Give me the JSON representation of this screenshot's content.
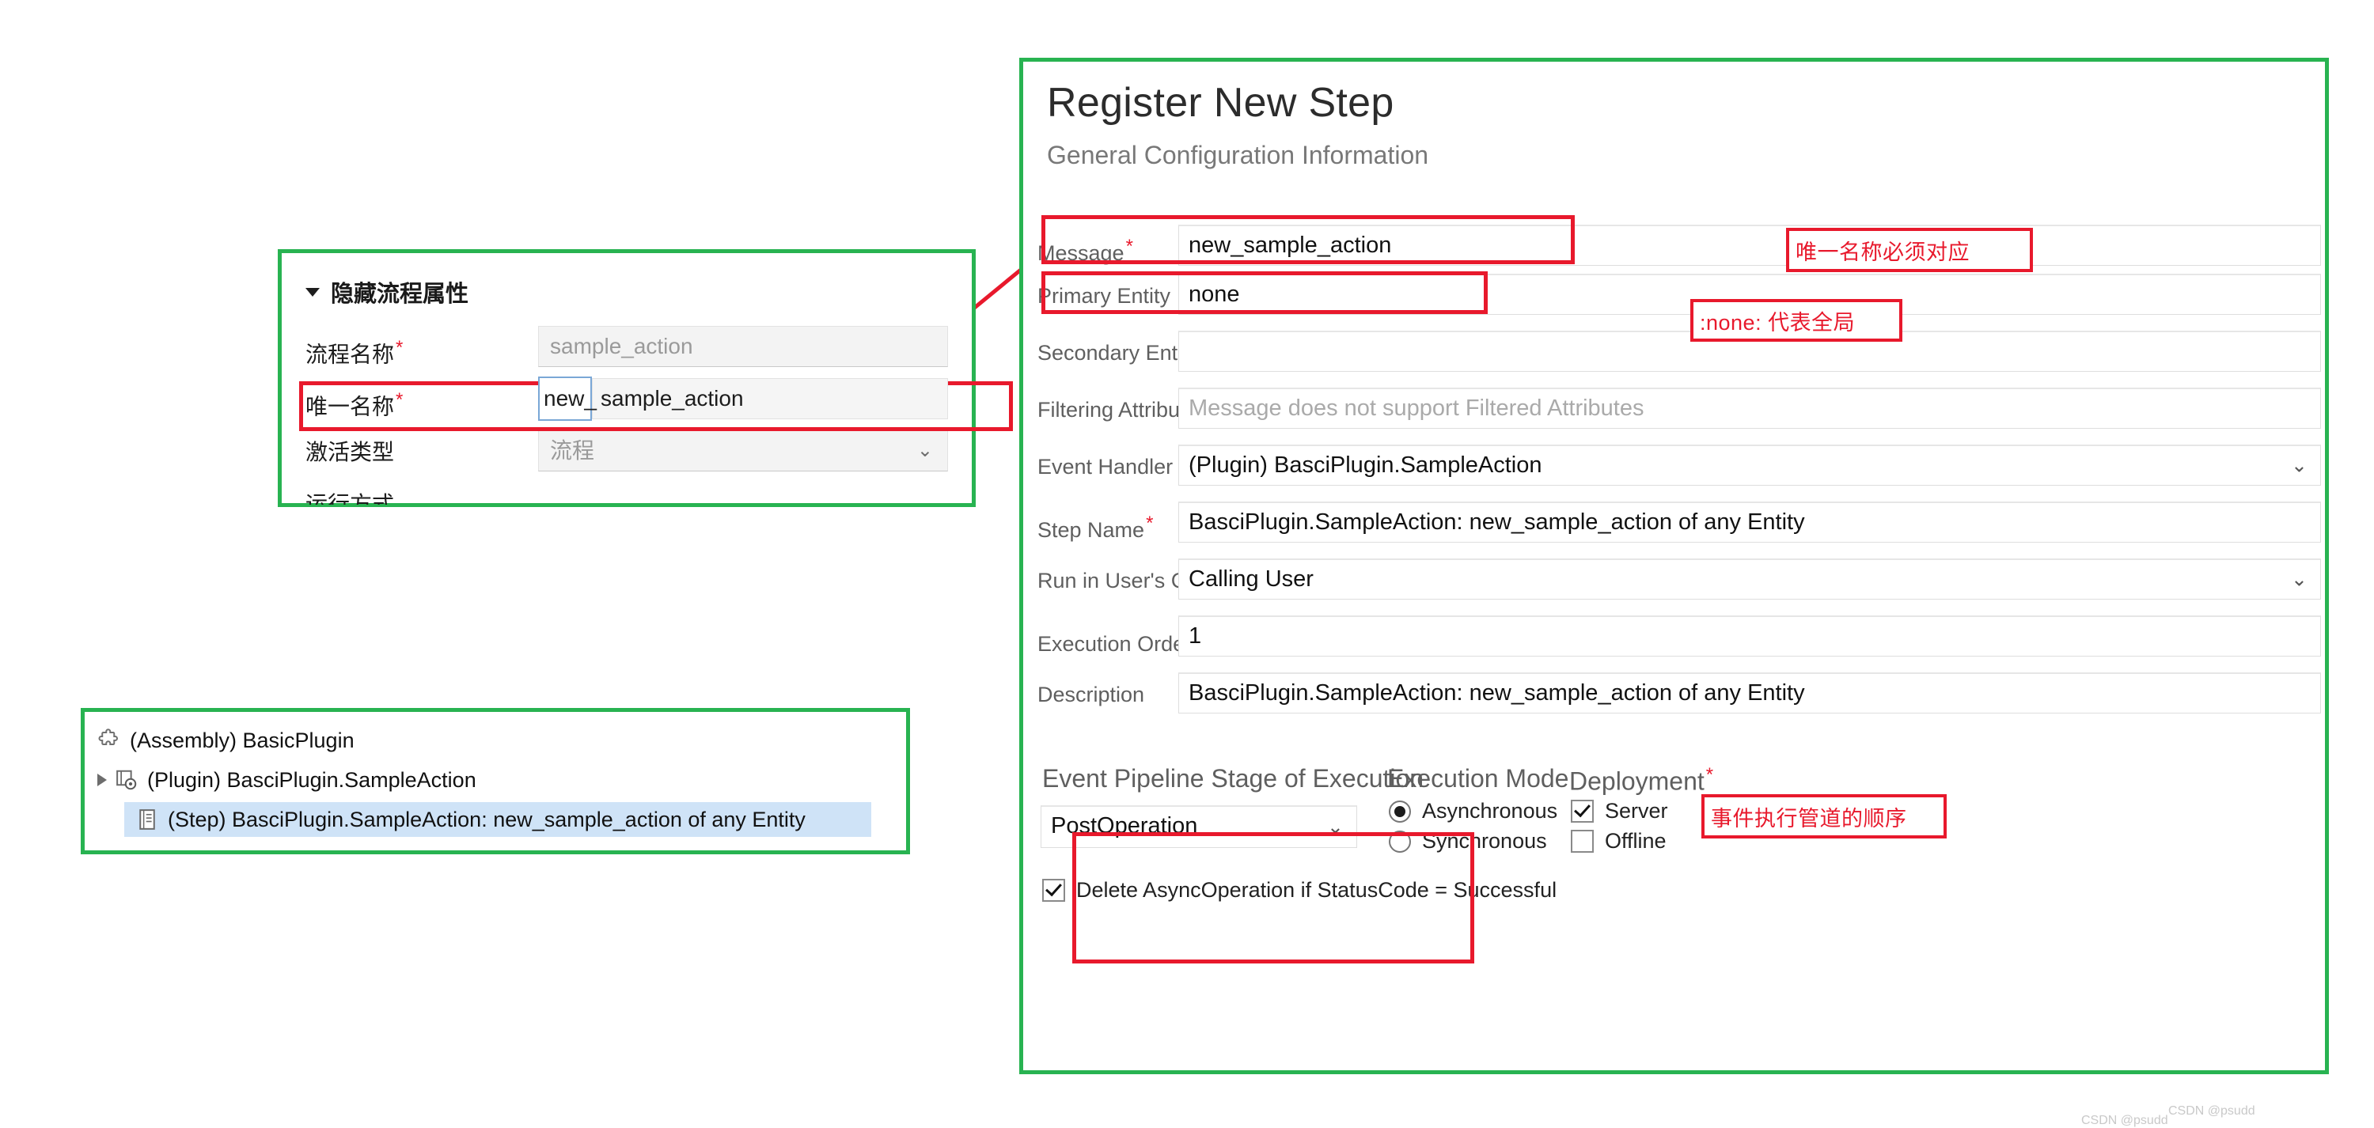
{
  "flow_panel": {
    "header": "隐藏流程属性",
    "rows": [
      {
        "label": "流程名称",
        "required": true,
        "value": "sample_action",
        "type": "text",
        "muted": true
      },
      {
        "label": "唯一名称",
        "required": true,
        "prefix": "new_",
        "value": "sample_action",
        "type": "prefixed"
      },
      {
        "label": "激活类型",
        "required": false,
        "value": "流程",
        "type": "select",
        "muted": true
      }
    ],
    "cut_off_label": "运行方式"
  },
  "tree_panel": {
    "nodes": [
      {
        "icon": "assembly-icon",
        "label": "(Assembly) BasicPlugin",
        "indent": 0,
        "expander": false,
        "selected": false
      },
      {
        "icon": "plugin-icon",
        "label": "(Plugin) BasciPlugin.SampleAction",
        "indent": 1,
        "expander": true,
        "selected": false
      },
      {
        "icon": "step-icon",
        "label": "(Step) BasciPlugin.SampleAction: new_sample_action of any Entity",
        "indent": 2,
        "expander": false,
        "selected": true
      }
    ]
  },
  "register_panel": {
    "title": "Register New Step",
    "subtitle": "General Configuration Information",
    "fields": [
      {
        "label": "Message",
        "required": true,
        "value": "new_sample_action",
        "type": "text"
      },
      {
        "label": "Primary Entity",
        "required": false,
        "value": "none",
        "type": "text"
      },
      {
        "label": "Secondary Entity",
        "required": false,
        "value": "",
        "type": "text"
      },
      {
        "label": "Filtering Attributes",
        "required": false,
        "value": "Message does not support Filtered Attributes",
        "type": "text",
        "placeholder": true
      },
      {
        "label": "Event Handler",
        "required": false,
        "value": "(Plugin) BasciPlugin.SampleAction",
        "type": "select"
      },
      {
        "label": "Step Name",
        "required": true,
        "value": "BasciPlugin.SampleAction: new_sample_action of any Entity",
        "type": "text"
      },
      {
        "label": "Run in User's Context",
        "required": false,
        "value": "Calling User",
        "type": "select"
      },
      {
        "label": "Execution Order",
        "required": true,
        "value": "1",
        "type": "text"
      },
      {
        "label": "Description",
        "required": false,
        "value": "BasciPlugin.SampleAction: new_sample_action of any Entity",
        "type": "text"
      }
    ],
    "pipeline": {
      "heading": "Event Pipeline Stage of Execution",
      "value": "PostOperation"
    },
    "execution_mode": {
      "heading": "Execution Mode",
      "options": [
        {
          "label": "Asynchronous",
          "selected": true
        },
        {
          "label": "Synchronous",
          "selected": false
        }
      ]
    },
    "deployment": {
      "heading": "Deployment",
      "required": true,
      "options": [
        {
          "label": "Server",
          "checked": true
        },
        {
          "label": "Offline",
          "checked": false
        }
      ]
    },
    "delete_async": {
      "label": "Delete AsyncOperation if StatusCode = Successful",
      "checked": true
    }
  },
  "annotations": [
    {
      "id": "anno-unique-name",
      "text": "唯一名称必须对应"
    },
    {
      "id": "anno-none-global",
      "text": ":none: 代表全局"
    },
    {
      "id": "anno-pipeline-order",
      "text": "事件执行管道的顺序"
    }
  ],
  "watermark": {
    "text_a": "CSDN @psudd",
    "text_b": "CSDN @psudd"
  },
  "colors": {
    "green_border": "#28b351",
    "red_highlight": "#e8192c",
    "selection_blue": "#cfe3f7"
  }
}
